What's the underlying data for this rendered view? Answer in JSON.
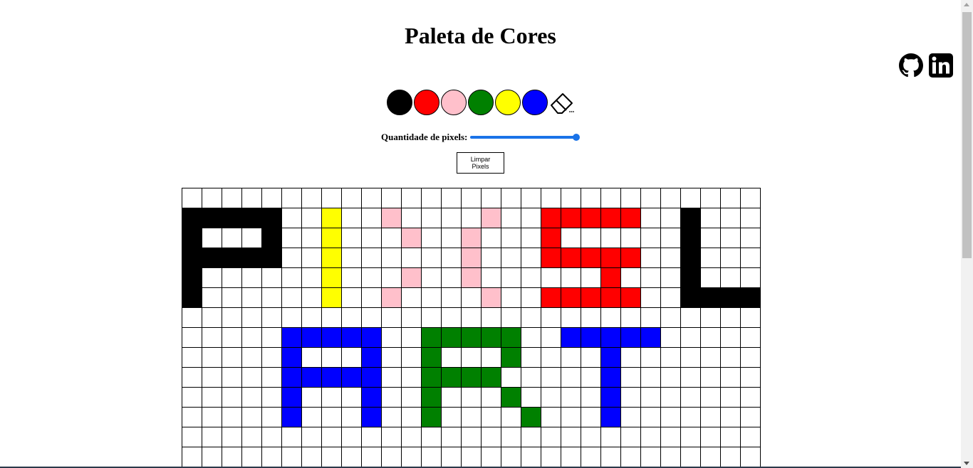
{
  "header": {
    "title": "Paleta de Cores"
  },
  "social": [
    {
      "name": "github-icon",
      "icon": "github"
    },
    {
      "name": "linkedin-icon",
      "icon": "linkedin"
    }
  ],
  "palette": {
    "colors": [
      "#000000",
      "#ff0000",
      "#ffc0cb",
      "#008000",
      "#ffff00",
      "#0000ff"
    ],
    "eraser_icon": "eraser"
  },
  "board_size": {
    "label": "Quantidade de pixels:",
    "value_fraction": 1.0
  },
  "clear_button": {
    "label": "Limpar Pixels"
  },
  "board": {
    "columns": 29,
    "legend": {
      ".": "#ffffff",
      "K": "#000000",
      "R": "#ff0000",
      "P": "#ffc0cb",
      "G": "#008000",
      "Y": "#ffff00",
      "B": "#0000ff"
    },
    "rows": [
      ".............................",
      "KKKKK..Y..P....P..RRRRR..K...",
      "K...K..Y...P..P...R......K...",
      "KKKKK..Y......P...RRRRR..K...",
      "K......Y...P..P......R...K...",
      "K......Y..P....P..RRRRR..KKKK",
      ".............................",
      ".....BBBBB..GGGGG..BBBBB.....",
      ".....B...B..G...G....B.......",
      ".....BBBBB..GGGG.....B.......",
      ".....B...B..G...G....B.......",
      ".....B...B..G....G...B.......",
      ".............................",
      "............................."
    ]
  }
}
